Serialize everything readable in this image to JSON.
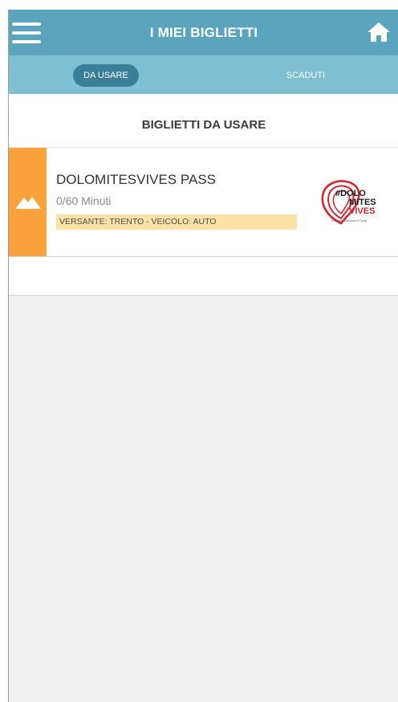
{
  "header": {
    "title": "I MIEI BIGLIETTI",
    "menu_icon": "hamburger-menu-icon",
    "home_icon": "home-icon"
  },
  "tabs": [
    {
      "label": "DA USARE",
      "active": true
    },
    {
      "label": "SCADUTI",
      "active": false
    }
  ],
  "section": {
    "title": "BIGLIETTI DA USARE"
  },
  "tickets": [
    {
      "name": "DOLOMITESVIVES PASS",
      "minutes": "0/60 Minuti",
      "tag": "VERSANTE: TRENTO - VEICOLO: AUTO",
      "icon": "mountain-icon",
      "logo": {
        "line1": "#DOLO",
        "line2": "MITES",
        "line3": "VIVES",
        "caption": "Provincia Autonoma di Trento"
      }
    }
  ],
  "colors": {
    "header_bg": "#5aa5bd",
    "tabs_bg": "#7ec0d1",
    "active_tab_bg": "#3a7f98",
    "ticket_stripe": "#f9a23b",
    "tag_bg": "#fde2a8",
    "logo_red": "#d7252f"
  }
}
